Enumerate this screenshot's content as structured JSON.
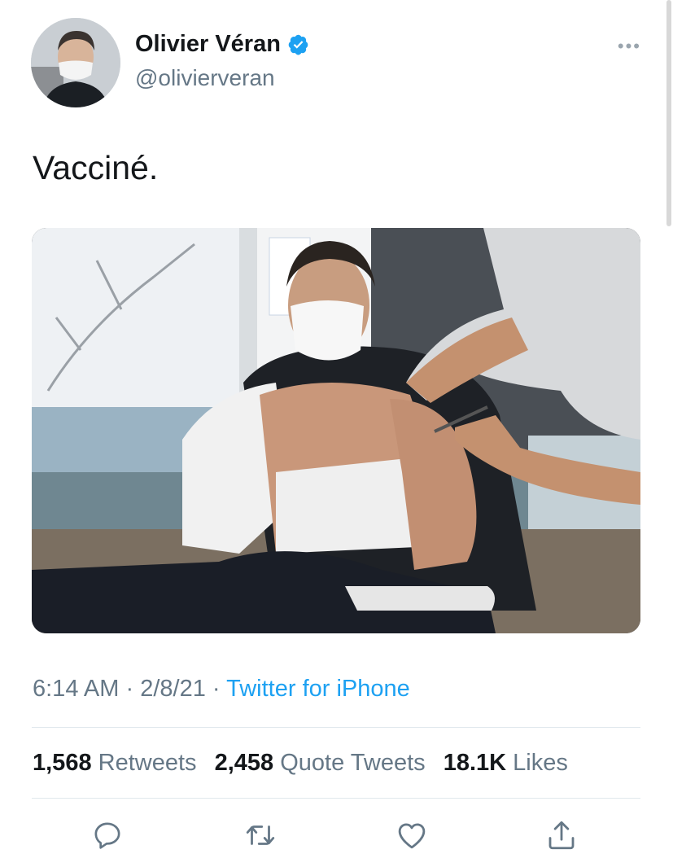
{
  "author": {
    "display_name": "Olivier Véran",
    "handle": "@olivierveran",
    "verified_icon": "verified-badge-icon",
    "more_label": "•••"
  },
  "tweet": {
    "text": "Vacciné."
  },
  "meta": {
    "time": "6:14 AM",
    "date": "2/8/21",
    "separator": "·",
    "source": "Twitter for iPhone"
  },
  "stats": {
    "retweets_count": "1,568",
    "retweets_label": "Retweets",
    "quote_count": "2,458",
    "quote_label": "Quote Tweets",
    "likes_count": "18.1K",
    "likes_label": "Likes"
  },
  "actions": [
    {
      "icon": "reply-icon"
    },
    {
      "icon": "retweet-icon"
    },
    {
      "icon": "like-icon"
    },
    {
      "icon": "share-icon"
    }
  ],
  "colors": {
    "accent": "#1da1f2",
    "text": "#14171a",
    "secondary": "#657786",
    "divider": "#e1e8ed"
  }
}
